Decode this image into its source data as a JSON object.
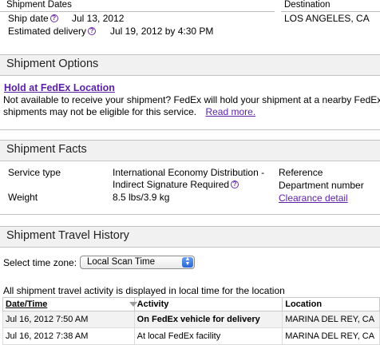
{
  "shipment_dates": {
    "heading": "Shipment Dates",
    "ship_date_label": "Ship date",
    "ship_date_value": "Jul 13, 2012",
    "est_delivery_label": "Estimated delivery",
    "est_delivery_value": "Jul 19, 2012 by 4:30 PM"
  },
  "destination": {
    "heading": "Destination",
    "value": "LOS ANGELES, CA"
  },
  "shipment_options": {
    "title": "Shipment Options",
    "hold_link": "Hold at FedEx Location",
    "description_line1": "Not available to receive your shipment? FedEx will hold your shipment at a nearby FedEx",
    "description_line2": "shipments may not be eligible for this service.",
    "read_more": "Read more."
  },
  "shipment_facts": {
    "title": "Shipment Facts",
    "service_type_label": "Service type",
    "service_type_line1": "International Economy Distribution -",
    "service_type_line2": "Indirect Signature Required",
    "weight_label": "Weight",
    "weight_value": "8.5 lbs/3.9 kg",
    "reference_label": "Reference",
    "department_label": "Department number",
    "clearance_link": "Clearance detail"
  },
  "travel_history": {
    "title": "Shipment Travel History",
    "timezone_label": "Select time zone:",
    "timezone_value": "Local Scan Time",
    "note": "All shipment travel activity is displayed in local time for the location",
    "columns": [
      "Date/Time",
      "Activity",
      "Location"
    ],
    "rows": [
      {
        "datetime": "Jul 16, 2012 7:50 AM",
        "activity": "On FedEx vehicle for delivery",
        "location": "MARINA DEL REY, CA"
      },
      {
        "datetime": "Jul 16, 2012 7:38 AM",
        "activity": "At local FedEx facility",
        "location": "MARINA DEL REY, CA"
      }
    ]
  },
  "icons": {
    "help": "question-circle-icon",
    "sort": "sort-descending-icon",
    "select_arrows": "select-updown-icon"
  },
  "colors": {
    "link": "#5a1fa6",
    "section_band": "#f1f1f1",
    "select_arrow": "#2a66d6"
  }
}
